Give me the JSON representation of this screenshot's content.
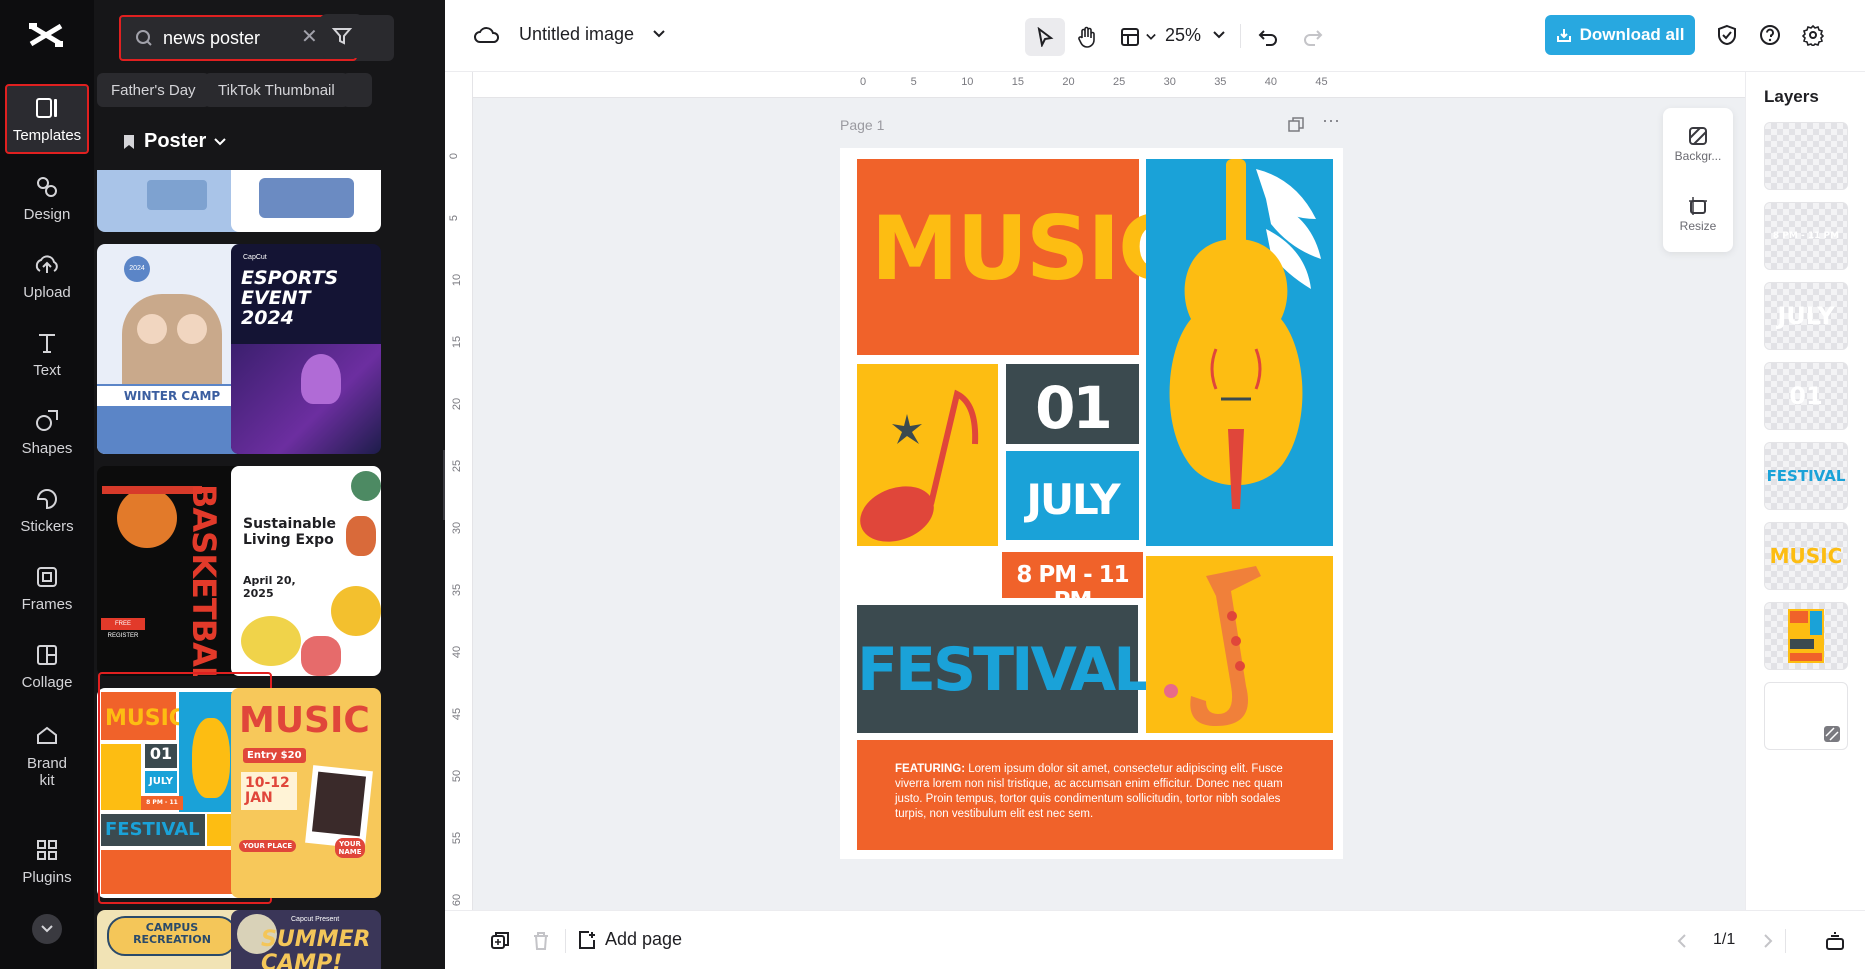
{
  "rail": {
    "items": [
      {
        "label": "Templates",
        "icon": "templates-icon"
      },
      {
        "label": "Design",
        "icon": "design-icon"
      },
      {
        "label": "Upload",
        "icon": "upload-icon"
      },
      {
        "label": "Text",
        "icon": "text-icon"
      },
      {
        "label": "Shapes",
        "icon": "shapes-icon"
      },
      {
        "label": "Stickers",
        "icon": "stickers-icon"
      },
      {
        "label": "Frames",
        "icon": "frames-icon"
      },
      {
        "label": "Collage",
        "icon": "collage-icon"
      },
      {
        "label": "Brand kit",
        "icon": "brand-kit-icon"
      },
      {
        "label": "Plugins",
        "icon": "plugins-icon"
      }
    ]
  },
  "panel": {
    "search_value": "news poster",
    "chips": [
      "Father's Day",
      "TikTok Thumbnail"
    ],
    "section_title": "Poster",
    "thumbs": {
      "winter": {
        "title": "WINTER CAMP",
        "date": "2024"
      },
      "esports": {
        "brand": "CapCut",
        "title": "ESPORTS EVENT 2024"
      },
      "basketball": {
        "title": "BASKETBALL",
        "cta": "FREE REGISTER"
      },
      "expo": {
        "title": "Sustainable Living Expo",
        "date": "April 20, 2025"
      },
      "music": {
        "title": "MUSIC",
        "day": "01",
        "month": "JULY",
        "time": "8 PM - 11 PM",
        "sub": "FESTIVAL"
      },
      "music2": {
        "title": "MUSIC",
        "price": "Entry $20",
        "dates": "10-12 JAN",
        "place": "YOUR PLACE",
        "name": "YOUR NAME"
      },
      "campus": {
        "title": "CAMPUS RECREATION"
      },
      "summer": {
        "brand": "Capcut Present",
        "title": "SUMMER CAMP!"
      }
    }
  },
  "topbar": {
    "doc_title": "Untitled image",
    "zoom": "25%",
    "download_label": "Download all"
  },
  "canvas": {
    "page_label": "Page 1",
    "ruler_top": [
      "0",
      "5",
      "10",
      "15",
      "20",
      "25",
      "30",
      "35",
      "40",
      "45"
    ],
    "ruler_left": [
      "0",
      "5",
      "10",
      "15",
      "20",
      "25",
      "30",
      "35",
      "40",
      "45",
      "50",
      "55",
      "60"
    ],
    "poster": {
      "title": "MUSIC",
      "day": "01",
      "month": "JULY",
      "time": "8 PM - 11 PM",
      "festival": "FESTIVAL",
      "featuring_label": "FEATURING:",
      "featuring_text": "Lorem ipsum dolor sit amet, consectetur adipiscing elit. Fusce viverra lorem non nisl tristique, ac accumsan enim efficitur. Donec nec quam justo. Proin tempus, tortor quis condimentum sollicitudin, tortor nibh sodales turpis, non vestibulum elit est nec sem."
    },
    "float_tools": {
      "background": "Backgr...",
      "resize": "Resize"
    }
  },
  "layers": {
    "title": "Layers",
    "items": [
      {
        "label": ""
      },
      {
        "label": "8 PM - 11 PM"
      },
      {
        "label": "JULY"
      },
      {
        "label": "01"
      },
      {
        "label": "FESTIVAL"
      },
      {
        "label": "MUSIC"
      },
      {
        "label": ""
      },
      {
        "label": ""
      }
    ]
  },
  "bottombar": {
    "add_page_label": "Add page",
    "page_indicator": "1/1"
  },
  "colors": {
    "orange": "#f0622a",
    "yellow": "#fdbd12",
    "blue": "#1aa2d8",
    "dark": "#3b4a4f",
    "accent": "#28a8e0",
    "highlight": "#e02020"
  }
}
